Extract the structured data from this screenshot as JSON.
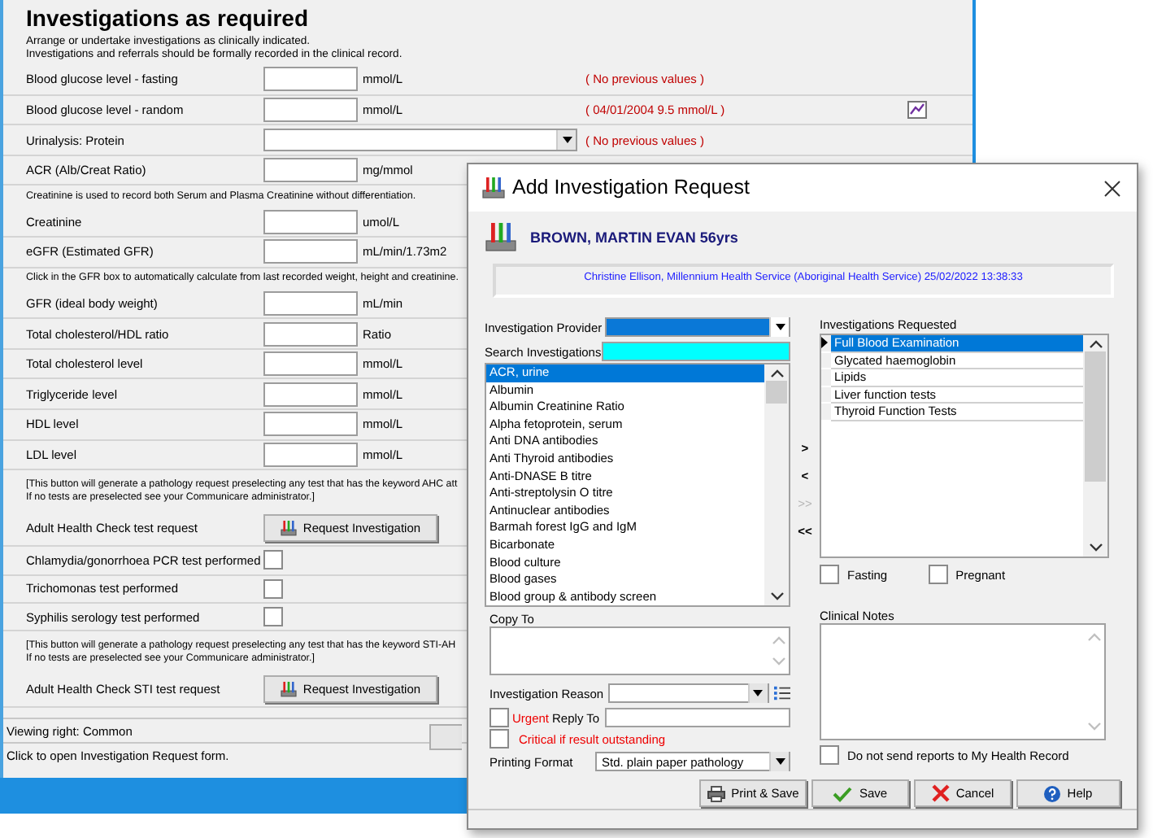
{
  "background_window": {
    "title": "Investigations as required",
    "intro": [
      "Arrange or undertake investigations as clinically indicated.",
      "Investigations and referrals should be formally recorded in the clinical record."
    ],
    "rows": [
      {
        "kind": "field",
        "label": "Blood glucose level - fasting",
        "unit": "mmol/L",
        "previous": "( No previous values )",
        "graph": false
      },
      {
        "kind": "field",
        "label": "Blood glucose level - random",
        "unit": "mmol/L",
        "previous": "( 04/01/2004  9.5 mmol/L )",
        "graph": true
      },
      {
        "kind": "dropdown",
        "label": "Urinalysis: Protein",
        "previous": "( No previous values )"
      },
      {
        "kind": "field",
        "label": "ACR (Alb/Creat Ratio)",
        "unit": "mg/mmol"
      },
      {
        "kind": "note",
        "lines": [
          "Creatinine is used to record both Serum and Plasma Creatinine without differentiation."
        ]
      },
      {
        "kind": "field",
        "label": "Creatinine",
        "unit": "umol/L"
      },
      {
        "kind": "field",
        "label": "eGFR (Estimated GFR)",
        "unit": "mL/min/1.73m2"
      },
      {
        "kind": "note",
        "lines": [
          "Click in the GFR box to automatically calculate from last recorded weight, height and creatinine."
        ]
      },
      {
        "kind": "field",
        "label": "GFR (ideal body weight)",
        "unit": "mL/min"
      },
      {
        "kind": "field",
        "label": "Total cholesterol/HDL ratio",
        "unit": "Ratio"
      },
      {
        "kind": "field",
        "label": "Total cholesterol level",
        "unit": "mmol/L"
      },
      {
        "kind": "field",
        "label": "Triglyceride level",
        "unit": "mmol/L"
      },
      {
        "kind": "field",
        "label": "HDL level",
        "unit": "mmol/L"
      },
      {
        "kind": "field",
        "label": "LDL level",
        "unit": "mmol/L"
      },
      {
        "kind": "note",
        "lines": [
          "[This button will generate a pathology request preselecting any test that has the keyword AHC att",
          "If no tests are preselected see your Communicare administrator.]"
        ]
      },
      {
        "kind": "button",
        "label": "Adult Health Check test request",
        "button": "Request Investigation"
      },
      {
        "kind": "checkbox",
        "label": "Chlamydia/gonorrhoea PCR test performed",
        "checked": false
      },
      {
        "kind": "checkbox",
        "label": "Trichomonas test performed",
        "checked": false
      },
      {
        "kind": "checkbox",
        "label": "Syphilis serology test performed",
        "checked": false
      },
      {
        "kind": "note",
        "lines": [
          "[This button will generate a pathology request preselecting any test that has the keyword STI-AH",
          "If no tests are preselected see your Communicare administrator.]"
        ]
      },
      {
        "kind": "button",
        "label": "Adult Health Check STI test request",
        "button": "Request Investigation"
      }
    ],
    "status": "Viewing right: Common",
    "hint": "Click to open Investigation Request form."
  },
  "dialog": {
    "title": "Add Investigation Request",
    "patient": "BROWN, MARTIN EVAN 56yrs",
    "info": "Christine Ellison, Millennium Health Service (Aboriginal Health Service) 25/02/2022 13:38:33",
    "provider_label": "Investigation Provider",
    "search_label": "Search Investigations",
    "investigations": [
      {
        "label": "ACR, urine",
        "selected": true
      },
      {
        "label": "Albumin",
        "selected": false
      },
      {
        "label": "Albumin Creatinine Ratio",
        "selected": false
      },
      {
        "label": "Alpha fetoprotein, serum",
        "selected": false
      },
      {
        "label": "Anti DNA antibodies",
        "selected": false
      },
      {
        "label": "Anti Thyroid antibodies",
        "selected": false
      },
      {
        "label": "Anti-DNASE B titre",
        "selected": false
      },
      {
        "label": "Anti-streptolysin O titre",
        "selected": false
      },
      {
        "label": "Antinuclear antibodies",
        "selected": false
      },
      {
        "label": "Barmah forest IgG and IgM",
        "selected": false
      },
      {
        "label": "Bicarbonate",
        "selected": false
      },
      {
        "label": "Blood culture",
        "selected": false
      },
      {
        "label": "Blood gases",
        "selected": false
      },
      {
        "label": "Blood group & antibody screen",
        "selected": false
      }
    ],
    "move_buttons": [
      {
        "label": ">",
        "disabled": false
      },
      {
        "label": "<",
        "disabled": false
      },
      {
        "label": ">>",
        "disabled": true
      },
      {
        "label": "<<",
        "disabled": false
      }
    ],
    "requested_label": "Investigations Requested",
    "requested": [
      {
        "label": "Full Blood Examination",
        "selected": true
      },
      {
        "label": "Glycated haemoglobin",
        "selected": false
      },
      {
        "label": "Lipids",
        "selected": false
      },
      {
        "label": "Liver function tests",
        "selected": false
      },
      {
        "label": "Thyroid Function Tests",
        "selected": false
      }
    ],
    "fasting": {
      "label": "Fasting",
      "checked": false
    },
    "pregnant": {
      "label": "Pregnant",
      "checked": false
    },
    "copy_to_label": "Copy To",
    "clinical_notes_label": "Clinical Notes",
    "reason_label": "Investigation Reason",
    "urgent": {
      "label": "Urgent",
      "checked": false
    },
    "reply_to_label": "Reply To",
    "critical": {
      "label": "Critical if result outstanding",
      "checked": false
    },
    "printing_format_label": "Printing Format",
    "printing_format": "Std. plain paper pathology",
    "mhr": {
      "label": "Do not send reports to My Health Record",
      "checked": false
    },
    "buttons": [
      {
        "kind": "print",
        "label": "Print & Save"
      },
      {
        "kind": "save",
        "label": "Save"
      },
      {
        "kind": "cancel",
        "label": "Cancel"
      },
      {
        "kind": "help",
        "label": "Help"
      }
    ]
  }
}
